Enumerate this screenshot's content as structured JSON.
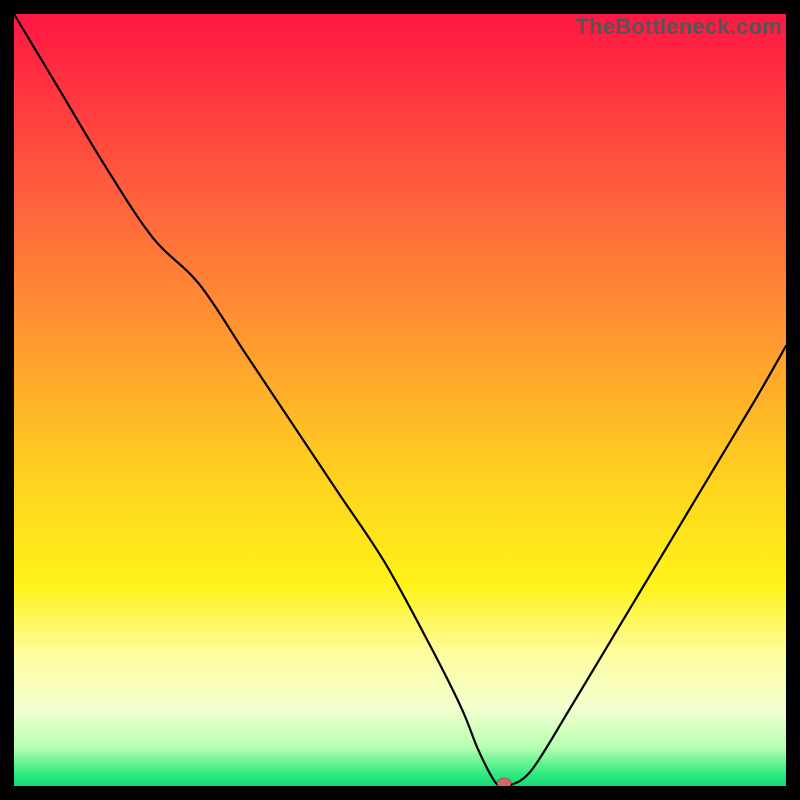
{
  "watermark": "TheBottleneck.com",
  "chart_data": {
    "type": "line",
    "title": "",
    "xlabel": "",
    "ylabel": "",
    "xlim": [
      0,
      100
    ],
    "ylim": [
      0,
      100
    ],
    "background_gradient_stops": [
      {
        "offset": 0.0,
        "color": "#ff1744"
      },
      {
        "offset": 0.12,
        "color": "#ff3b3f"
      },
      {
        "offset": 0.28,
        "color": "#ff6e3a"
      },
      {
        "offset": 0.45,
        "color": "#ffa22e"
      },
      {
        "offset": 0.6,
        "color": "#ffd11f"
      },
      {
        "offset": 0.74,
        "color": "#fff31a"
      },
      {
        "offset": 0.83,
        "color": "#fffca0"
      },
      {
        "offset": 0.9,
        "color": "#f2ffd0"
      },
      {
        "offset": 0.95,
        "color": "#b6ffb0"
      },
      {
        "offset": 0.985,
        "color": "#2fe97f"
      },
      {
        "offset": 1.0,
        "color": "#18d976"
      }
    ],
    "series": [
      {
        "name": "bottleneck-curve",
        "x": [
          0,
          6,
          12,
          18,
          24,
          30,
          36,
          42,
          48,
          54,
          58,
          60,
          62,
          63,
          64,
          67,
          72,
          78,
          84,
          90,
          96,
          100
        ],
        "y": [
          100,
          90,
          80,
          71,
          65,
          56,
          47,
          38,
          29,
          18,
          10,
          5,
          1,
          0,
          0,
          2,
          10,
          20,
          30,
          40,
          50,
          57
        ]
      }
    ],
    "marker": {
      "x": 63.5,
      "y": 0,
      "rx": 7,
      "ry": 5,
      "color": "#d06a6a"
    }
  }
}
